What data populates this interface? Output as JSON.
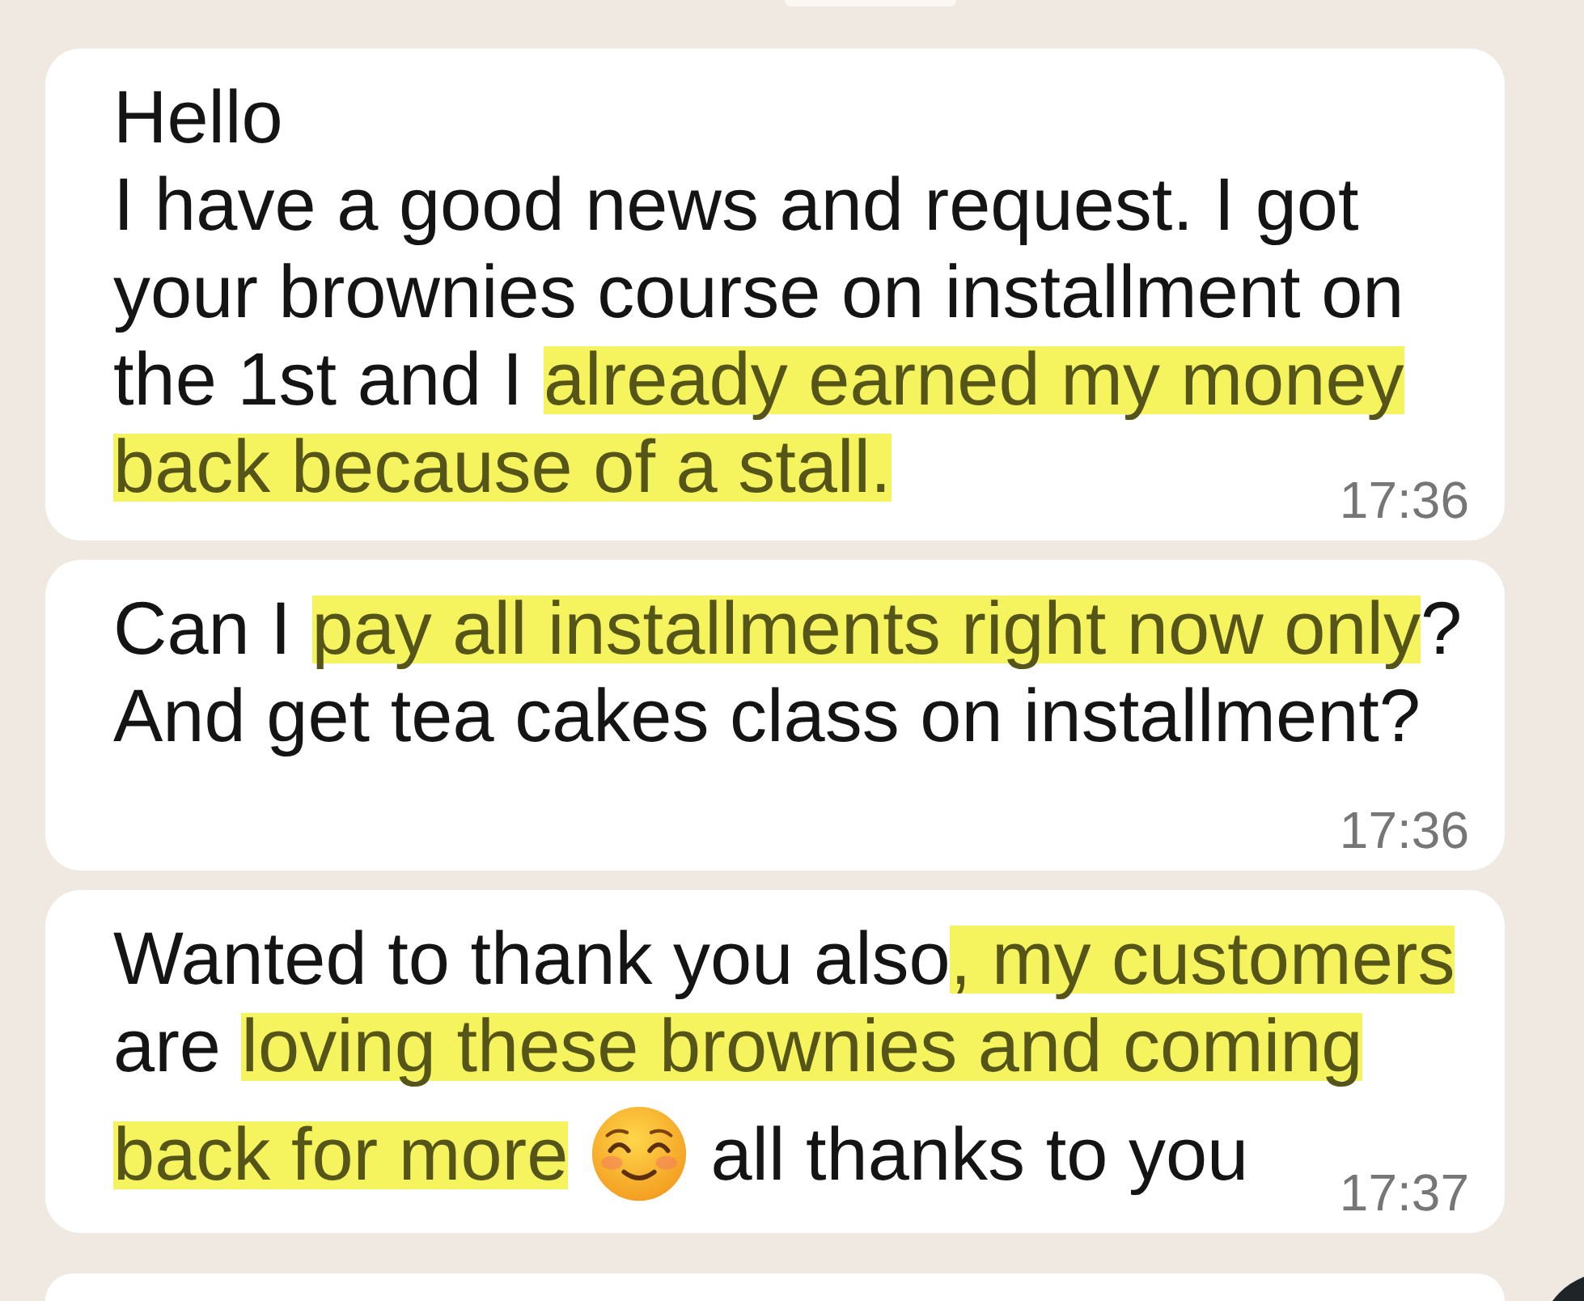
{
  "chat": {
    "messages": [
      {
        "rows": [
          {
            "parts": [
              {
                "kind": "text",
                "segments": [
                  {
                    "text": "Hello\nI have a good news and request. I got\nyour brownies course on installment on\nthe 1st and I ",
                    "highlighted": false
                  },
                  {
                    "text": "already earned my money\nback because of a stall.",
                    "highlighted": true
                  }
                ]
              }
            ]
          }
        ],
        "time": "17:36"
      },
      {
        "rows": [
          {
            "parts": [
              {
                "kind": "text",
                "segments": [
                  {
                    "text": "Can I ",
                    "highlighted": false
                  },
                  {
                    "text": "pay all installments right now only",
                    "highlighted": true
                  },
                  {
                    "text": "?\nAnd get tea cakes class on installment?",
                    "highlighted": false
                  }
                ]
              }
            ]
          }
        ],
        "time": "17:36"
      },
      {
        "rows": [
          {
            "parts": [
              {
                "kind": "text",
                "segments": [
                  {
                    "text": "Wanted to thank you also",
                    "highlighted": false
                  },
                  {
                    "text": ", my customers",
                    "highlighted": true
                  },
                  {
                    "text": "\nare ",
                    "highlighted": false
                  },
                  {
                    "text": "loving these brownies and coming",
                    "highlighted": true
                  }
                ]
              }
            ]
          },
          {
            "parts": [
              {
                "kind": "text",
                "segments": [
                  {
                    "text": "back for more",
                    "highlighted": true
                  }
                ]
              },
              {
                "kind": "emoji"
              },
              {
                "kind": "text",
                "segments": [
                  {
                    "text": "all thanks to you",
                    "highlighted": false
                  }
                ]
              }
            ]
          }
        ],
        "time": "17:37"
      }
    ]
  }
}
